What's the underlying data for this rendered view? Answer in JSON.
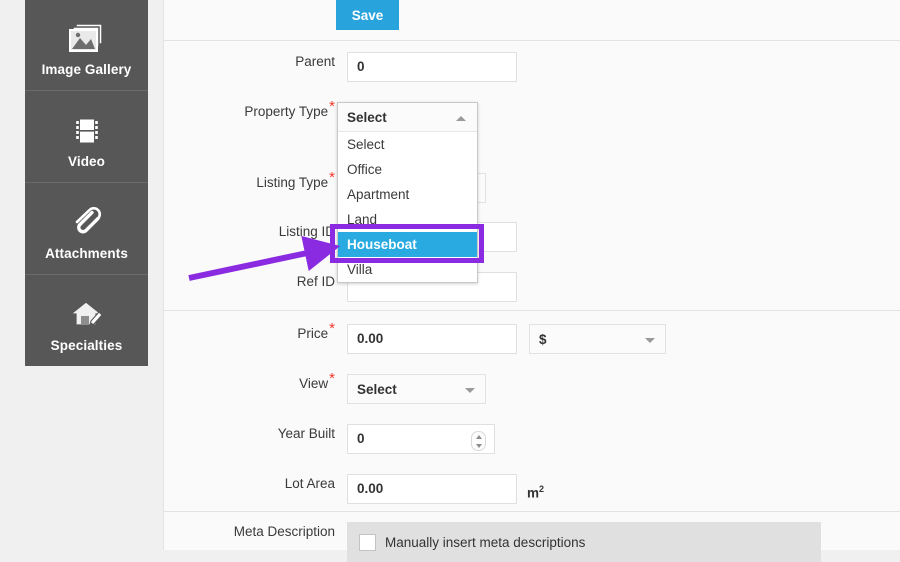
{
  "sidebar": {
    "items": [
      {
        "label": "Image Gallery",
        "icon": "image-gallery-icon"
      },
      {
        "label": "Video",
        "icon": "video-film-icon"
      },
      {
        "label": "Attachments",
        "icon": "paperclip-icon"
      },
      {
        "label": "Specialties",
        "icon": "house-pencil-icon"
      }
    ]
  },
  "toolbar": {
    "save_label": "Save"
  },
  "form": {
    "parent": {
      "label": "Parent",
      "value": "0",
      "required": false
    },
    "property_type": {
      "label": "Property Type",
      "value": "Select",
      "required": true
    },
    "listing_type": {
      "label": "Listing Type",
      "value": "",
      "required": true
    },
    "listing_id": {
      "label": "Listing ID",
      "value": "",
      "required": false
    },
    "ref_id": {
      "label": "Ref ID",
      "value": "",
      "required": false
    },
    "price": {
      "label": "Price",
      "value": "0.00",
      "required": true
    },
    "currency": {
      "label": "",
      "value": "$"
    },
    "view": {
      "label": "View",
      "value": "Select",
      "required": true
    },
    "year_built": {
      "label": "Year Built",
      "value": "0",
      "required": false
    },
    "lot_area": {
      "label": "Lot Area",
      "value": "0.00",
      "required": false,
      "unit": "m",
      "unit_sup": "2"
    },
    "meta_description": {
      "label": "Meta Description",
      "checkbox_label": "Manually insert meta descriptions",
      "checked": false
    }
  },
  "dropdown": {
    "name": "property-type-dropdown",
    "open": true,
    "header_value": "Select",
    "options": [
      "Select",
      "Office",
      "Apartment",
      "Land",
      "Houseboat",
      "Villa"
    ],
    "selected": "Houseboat",
    "selected_index": 4
  },
  "annotation": {
    "highlight_target": "Houseboat",
    "arrow_color": "#8a2be2",
    "highlight_color": "#8a2be2"
  },
  "colors": {
    "accent": "#29a3dc",
    "option_highlight": "#29abe2",
    "sidebar_bg": "#575757",
    "required_mark": "#f0352a",
    "page_bg": "#f0f0f0",
    "panel_bg": "#fafafa"
  }
}
